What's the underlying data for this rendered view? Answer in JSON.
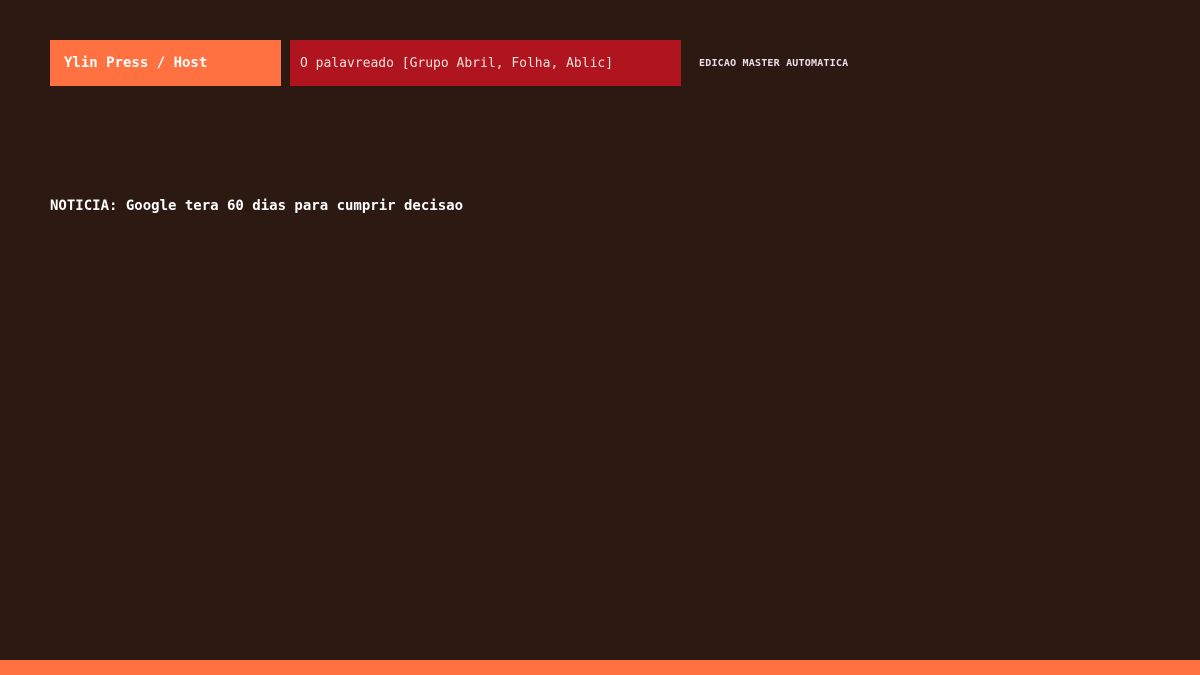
{
  "header": {
    "host_label": "Ylin Press / Host",
    "source_label": "O palavreado [Grupo Abril, Folha, Ablic]",
    "edition_label": "EDICAO MASTER AUTOMATICA"
  },
  "news": {
    "headline": "NOTICIA: Google tera 60 dias para cumprir decisao"
  },
  "colors": {
    "background": "#2c1912",
    "accent_orange": "#ff7140",
    "accent_red": "#b0141f"
  }
}
